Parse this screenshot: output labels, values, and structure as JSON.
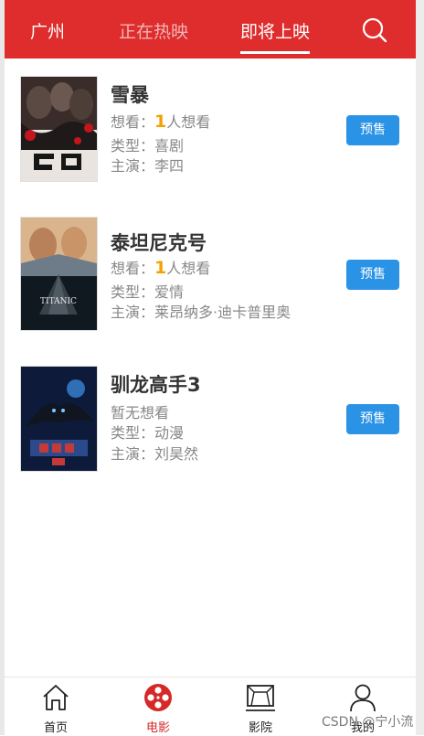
{
  "header": {
    "city": "广州",
    "tabs": [
      "正在热映",
      "即将上映"
    ],
    "search_icon": "search-icon"
  },
  "movies": [
    {
      "title": "雪暴",
      "want_prefix": "想看：",
      "want_count": "1",
      "want_suffix": "人想看",
      "type": "类型：喜剧",
      "cast": "主演：李四",
      "button": "预售"
    },
    {
      "title": "泰坦尼克号",
      "want_prefix": "想看：",
      "want_count": "1",
      "want_suffix": "人想看",
      "type": "类型：爱情",
      "cast": "主演：莱昂纳多·迪卡普里奥",
      "poster_text": "TITANIC",
      "button": "预售"
    },
    {
      "title": "驯龙高手3",
      "want_text": "暂无想看",
      "type": "类型：动漫",
      "cast": "主演：刘昊然",
      "button": "预售"
    }
  ],
  "tabbar": {
    "items": [
      {
        "label": "首页",
        "icon": "home-icon"
      },
      {
        "label": "电影",
        "icon": "film-reel-icon",
        "active": true
      },
      {
        "label": "影院",
        "icon": "cinema-screen-icon"
      },
      {
        "label": "我的",
        "icon": "user-icon"
      }
    ]
  },
  "watermark": "CSDN @宁小流",
  "colors": {
    "header_bg": "#df2c2c",
    "presale_bg": "#2b93e6",
    "want_count": "#f2a100",
    "active_tab": "#d62828"
  }
}
